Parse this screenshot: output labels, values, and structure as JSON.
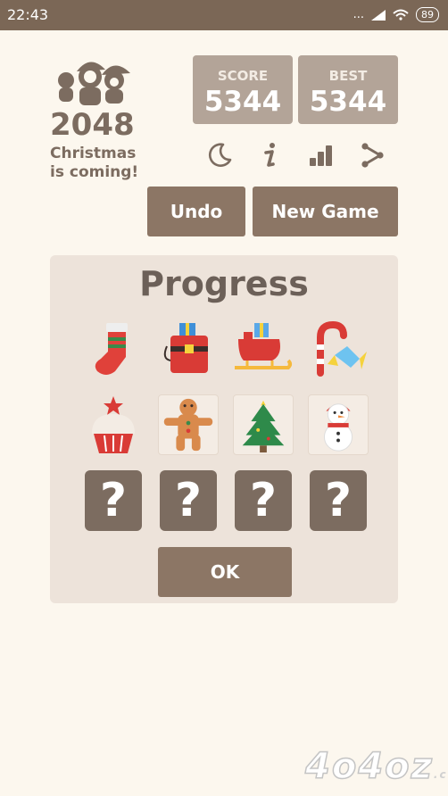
{
  "status_bar": {
    "time": "22:43",
    "signal_dots": "...",
    "battery": "89"
  },
  "app": {
    "title": "2048",
    "subtitle": "Christmas is coming!"
  },
  "score": {
    "label": "SCORE",
    "value": "5344"
  },
  "best": {
    "label": "BEST",
    "value": "5344"
  },
  "toolbar_icons": [
    "moon-icon",
    "info-icon",
    "leaderboard-icon",
    "share-icon"
  ],
  "buttons": {
    "undo": "Undo",
    "new_game": "New Game"
  },
  "progress": {
    "title": "Progress",
    "unlocked": [
      "stocking",
      "gift-bag",
      "sleigh",
      "candy-cane",
      "cupcake",
      "gingerbread-man",
      "christmas-tree",
      "snowman"
    ],
    "locked_symbol": "?",
    "ok_label": "OK"
  },
  "watermark": {
    "text": "4o4oz",
    "suffix": ".com"
  },
  "colors": {
    "accent": "#8c7665",
    "score_bg": "#b3a498",
    "panel": "#ede3da",
    "status_bar": "#7b6756"
  }
}
